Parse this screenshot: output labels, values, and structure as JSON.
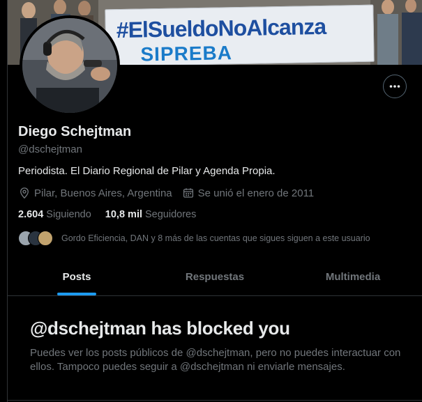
{
  "banner": {
    "sign_line1": "#ElSueldoNoAlcanza",
    "sign_line2": "SIPREBA"
  },
  "profile": {
    "name": "Diego Schejtman",
    "handle": "@dschejtman",
    "bio": "Periodista. El Diario Regional de Pilar y Agenda Propia.",
    "location": "Pilar, Buenos Aires, Argentina",
    "joined": "Se unió el enero de 2011",
    "following_count": "2.604",
    "following_label": "Siguiendo",
    "followers_count": "10,8 mil",
    "followers_label": "Seguidores",
    "known_followers_text": "Gordo Eficiencia, DAN y 8 más de las cuentas que sigues siguen a este usuario"
  },
  "tabs": [
    {
      "label": "Posts",
      "active": true
    },
    {
      "label": "Respuestas",
      "active": false
    },
    {
      "label": "Multimedia",
      "active": false
    }
  ],
  "blocked": {
    "title": "@dschejtman has blocked you",
    "body": "Puedes ver los posts públicos de @dschejtman, pero no puedes interactuar con ellos. Tampoco puedes seguir a @dschejtman ni enviarle mensajes."
  },
  "colors": {
    "accent": "#1d9bf0",
    "muted": "#71767b",
    "text": "#e7e9ea",
    "background": "#000000"
  },
  "icons": {
    "more": "more-horizontal-icon",
    "location": "location-pin-icon",
    "calendar": "calendar-icon"
  }
}
